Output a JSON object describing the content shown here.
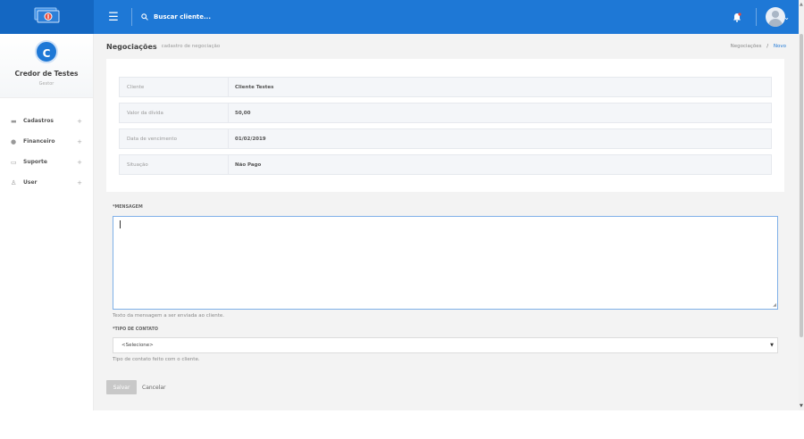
{
  "topbar": {
    "search_label": "Buscar cliente...",
    "logo_icon": "money-bills-icon",
    "menu_icon": "hamburger-icon",
    "notification_icon": "bell-icon",
    "colors": {
      "bar": "#1e78d6",
      "brand": "#1467c2"
    }
  },
  "sidebar": {
    "profile": {
      "initial": "C",
      "name": "Credor de Testes",
      "role": "Gestor"
    },
    "items": [
      {
        "label": "Cadastros",
        "icon": "folder-icon"
      },
      {
        "label": "Financeiro",
        "icon": "coin-icon"
      },
      {
        "label": "Suporte",
        "icon": "chat-icon"
      },
      {
        "label": "User",
        "icon": "user-icon"
      }
    ],
    "expand_symbol": "+"
  },
  "header": {
    "title": "Negociações",
    "subtitle": "cadastro de negociação",
    "breadcrumb": {
      "parent": "Negociações",
      "separator": "/",
      "current": "Novo"
    }
  },
  "details": [
    {
      "label": "Cliente",
      "value": "Cliente Testes"
    },
    {
      "label": "Valor da dívida",
      "value": "50,00"
    },
    {
      "label": "Data de vencimento",
      "value": "01/02/2019"
    },
    {
      "label": "Situação",
      "value": "Não Pago"
    }
  ],
  "form": {
    "message_label": "*MENSAGEM",
    "message_value": "",
    "message_help": "Texto da mensagem a ser enviada ao cliente.",
    "contact_label": "*TIPO DE CONTATO",
    "contact_selected": "<Selecione>",
    "contact_help": "Tipo de contato feito com o cliente.",
    "save_label": "Salvar",
    "cancel_label": "Cancelar"
  }
}
